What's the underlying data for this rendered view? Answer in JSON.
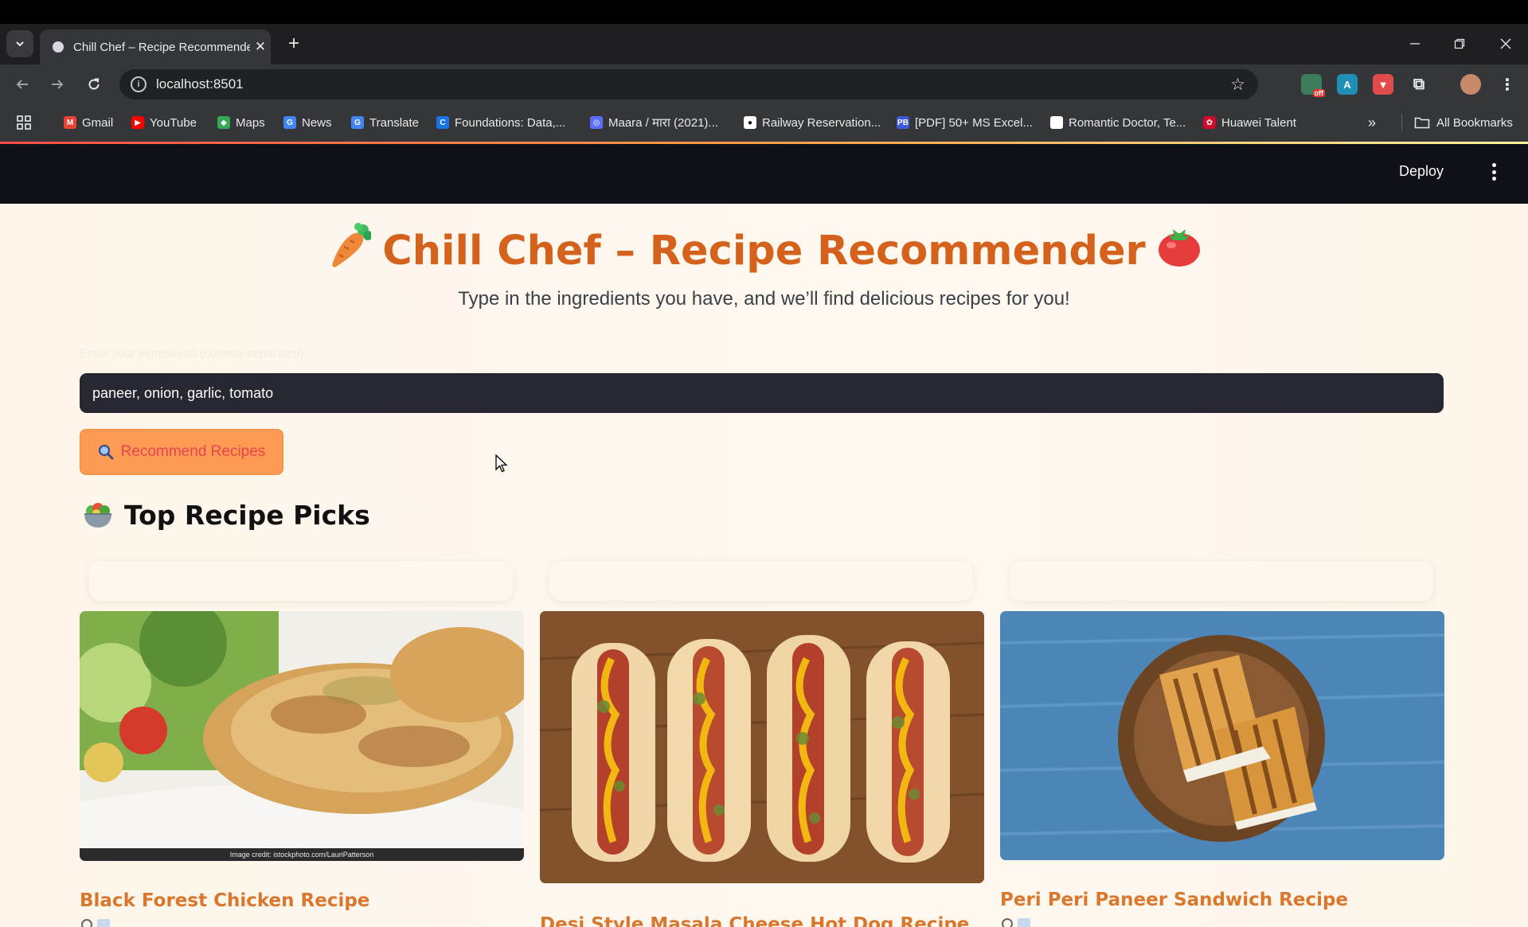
{
  "browser": {
    "tab_title": "Chill Chef – Recipe Recommender",
    "url": "localhost:8501",
    "bookmarks": [
      {
        "label": "Gmail",
        "color": "#ea4335"
      },
      {
        "label": "YouTube",
        "color": "#ff0000"
      },
      {
        "label": "Maps",
        "color": "#34a853"
      },
      {
        "label": "News",
        "color": "#4285f4"
      },
      {
        "label": "Translate",
        "color": "#4285f4"
      },
      {
        "label": "Foundations: Data,...",
        "color": "#1a73e8"
      },
      {
        "label": "Maara / मारा (2021)...",
        "color": "#5b6cff"
      },
      {
        "label": "Railway Reservation...",
        "color": "#ffffff"
      },
      {
        "label": "[PDF] 50+ MS Excel...",
        "color": "#3b5bdb"
      },
      {
        "label": "Romantic Doctor, Te...",
        "color": "#ffffff"
      },
      {
        "label": "Huawei Talent",
        "color": "#cf0a2c"
      }
    ],
    "all_bookmarks": "All Bookmarks",
    "extension_badge": "off"
  },
  "app": {
    "deploy_label": "Deploy",
    "title": "Chill Chef – Recipe Recommender",
    "subtitle": "Type in the ingredients you have, and we’ll find delicious recipes for you!",
    "input_label": "Enter your ingredients (comma-separated):",
    "ingredients_value": "paneer, onion, garlic, tomato",
    "button_label": "Recommend Recipes",
    "section_title": "Top Recipe Picks",
    "accent_color": "#d4621c",
    "recipes": [
      {
        "title": "Black Forest Chicken Recipe",
        "image_credit": "Image credit: istockphoto.com/LauriPatterson"
      },
      {
        "title": "Desi Style Masala Cheese Hot Dog Recipe"
      },
      {
        "title": "Peri Peri Paneer Sandwich Recipe"
      }
    ]
  }
}
